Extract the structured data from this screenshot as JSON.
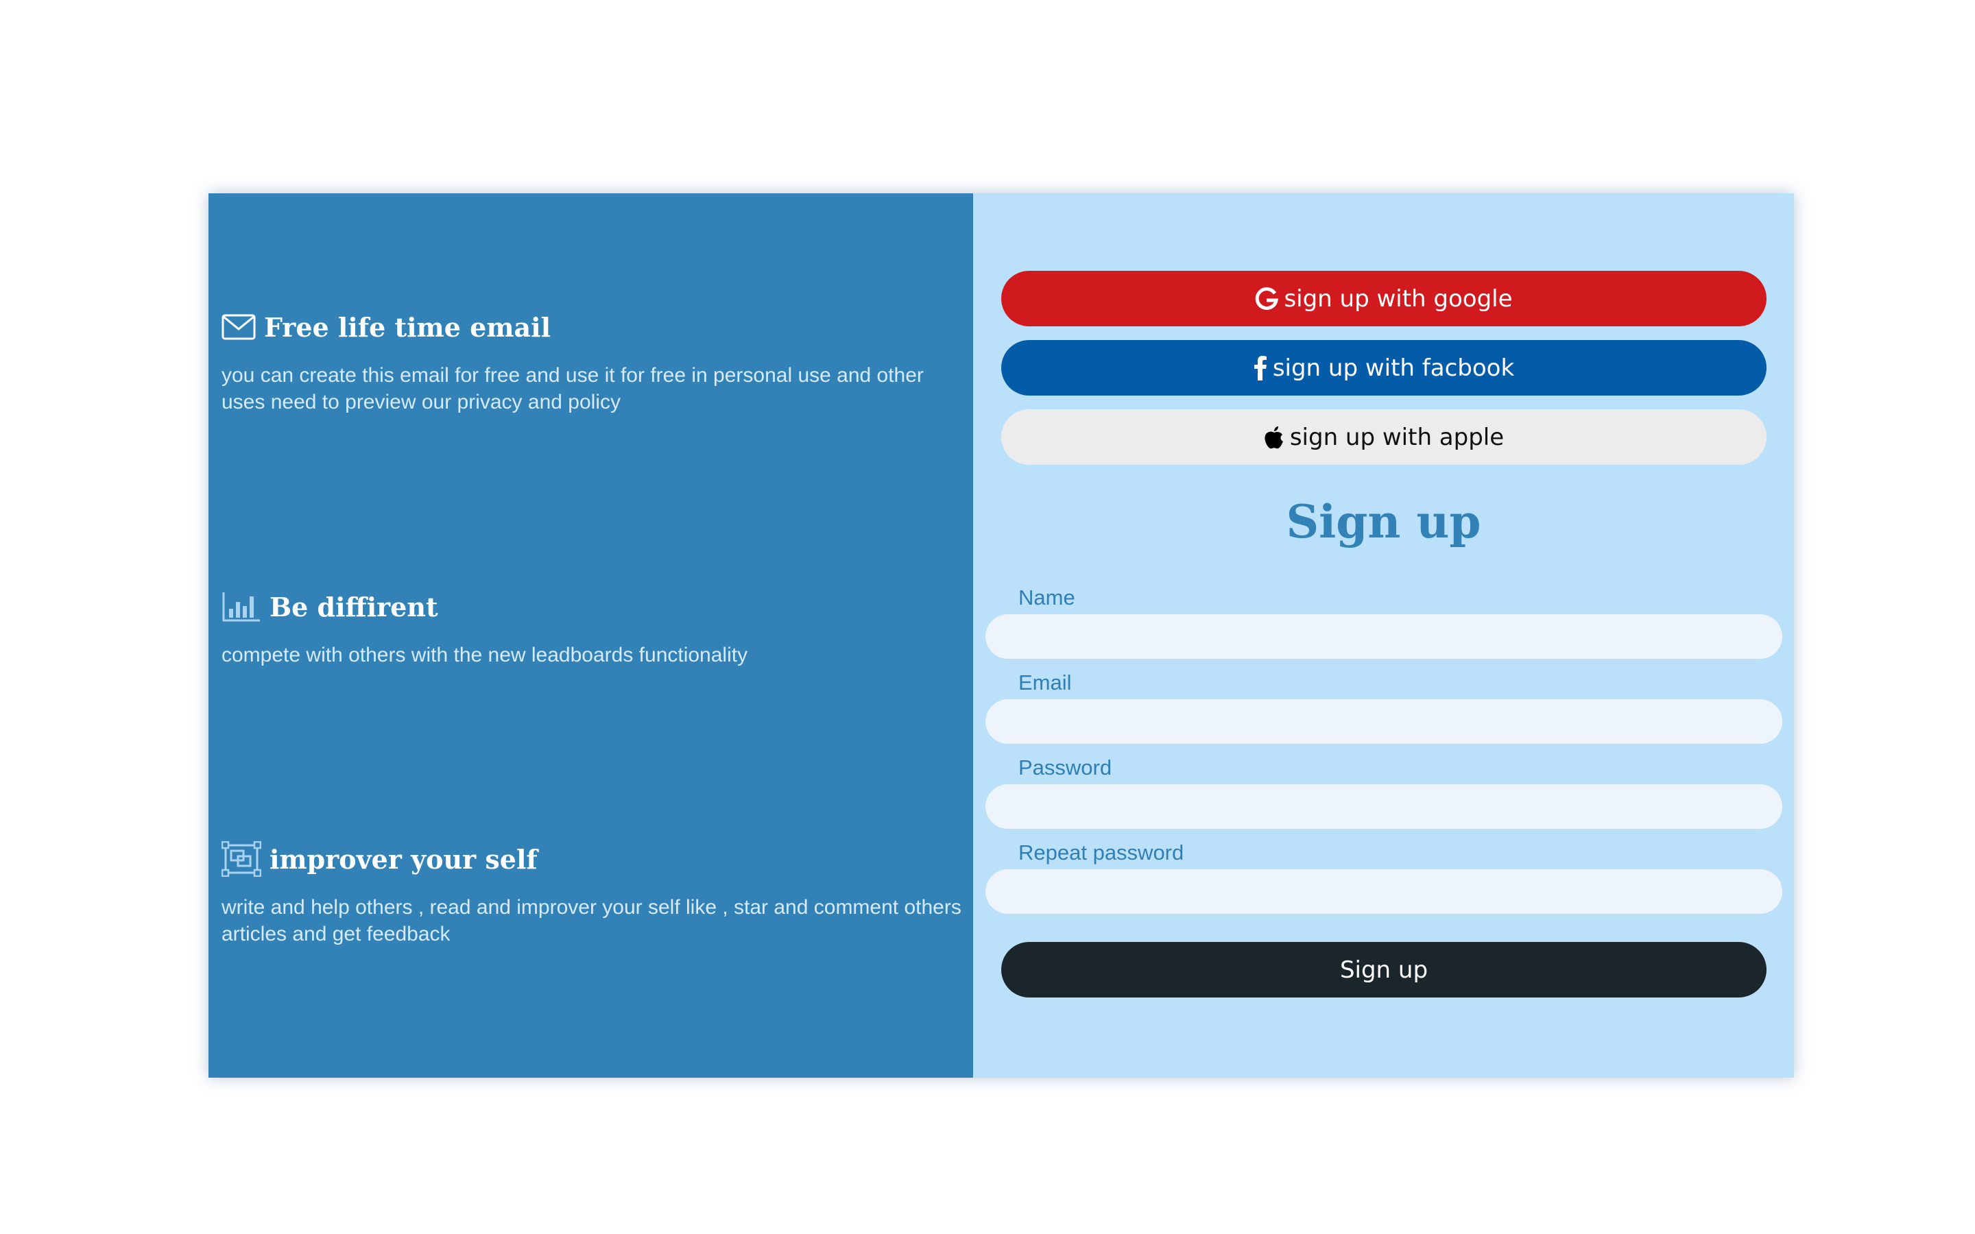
{
  "features": [
    {
      "icon": "envelope-icon",
      "title": "Free life time email",
      "description": "you can create this email for free and use it for free in personal use and other uses need to preview our privacy and policy"
    },
    {
      "icon": "bar-chart-icon",
      "title": "Be diffirent",
      "description": "compete with others with the new leadboards functionality"
    },
    {
      "icon": "frames-icon",
      "title": "improver your self",
      "description": "write and help others , read and improver your self like , star and comment others articles and get feedback"
    }
  ],
  "social": {
    "google": {
      "label": "sign up with google",
      "icon": "google-icon",
      "color": "#d11a1d"
    },
    "facebook": {
      "label": "sign up with facbook",
      "icon": "facebook-icon",
      "color": "#045ca9"
    },
    "apple": {
      "label": "sign up with apple",
      "icon": "apple-icon",
      "color": "#ececec"
    }
  },
  "form": {
    "title": "Sign up",
    "name_label": "Name",
    "name_value": "",
    "email_label": "Email",
    "email_value": "",
    "password_label": "Password",
    "password_value": "",
    "repeat_password_label": "Repeat password",
    "repeat_password_value": "",
    "submit_label": "Sign up"
  },
  "colors": {
    "left_panel": "#3282b8",
    "right_panel": "#bbe1fa",
    "submit": "#1b262c"
  }
}
